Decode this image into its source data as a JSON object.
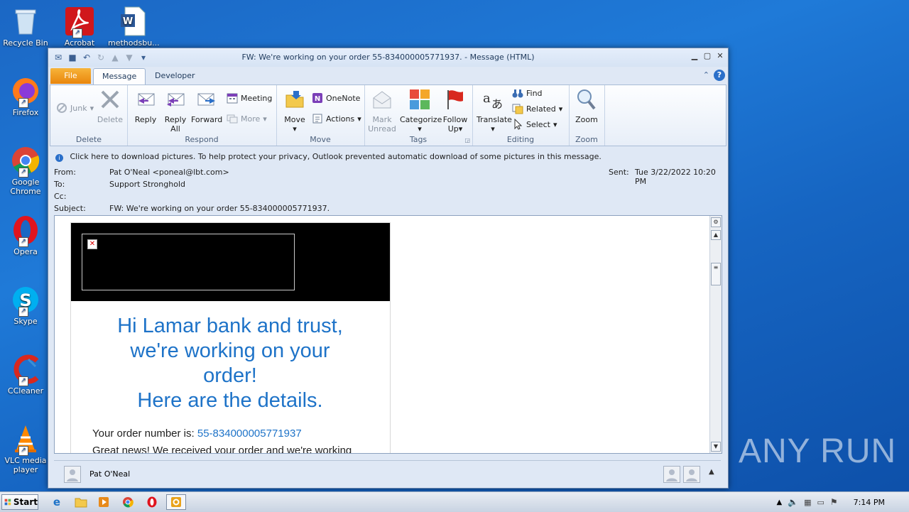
{
  "desktop": {
    "icons": [
      {
        "label": "Recycle Bin"
      },
      {
        "label": "Acrobat"
      },
      {
        "label": "methodsbu..."
      },
      {
        "label": "Firefox"
      },
      {
        "label": "Google Chrome"
      },
      {
        "label": "Opera"
      },
      {
        "label": "Skype"
      },
      {
        "label": "CCleaner"
      },
      {
        "label": "VLC media player"
      }
    ]
  },
  "window": {
    "title": "FW: We're working on your order 55-834000005771937. - Message (HTML)",
    "tabs": {
      "file": "File",
      "message": "Message",
      "developer": "Developer"
    }
  },
  "ribbon": {
    "groups": {
      "delete": "Delete",
      "respond": "Respond",
      "move": "Move",
      "tags": "Tags",
      "editing": "Editing",
      "zoom": "Zoom"
    },
    "buttons": {
      "junk": "Junk",
      "delete": "Delete",
      "reply": "Reply",
      "reply_all_1": "Reply",
      "reply_all_2": "All",
      "forward": "Forward",
      "meeting": "Meeting",
      "more": "More",
      "move": "Move",
      "onenote": "OneNote",
      "actions": "Actions",
      "mark_unread_1": "Mark",
      "mark_unread_2": "Unread",
      "categorize": "Categorize",
      "follow_up_1": "Follow",
      "follow_up_2": "Up",
      "translate": "Translate",
      "find": "Find",
      "related": "Related",
      "select": "Select",
      "zoom": "Zoom"
    }
  },
  "infobar": "Click here to download pictures. To help protect your privacy, Outlook prevented automatic download of some pictures in this message.",
  "header": {
    "from_label": "From:",
    "from_value": "Pat O'Neal <poneal@lbt.com>",
    "to_label": "To:",
    "to_value": "Support Stronghold",
    "cc_label": "Cc:",
    "subject_label": "Subject:",
    "subject_value": "FW: We're working on your order 55-834000005771937.",
    "sent_label": "Sent:",
    "sent_value": "Tue 3/22/2022 10:20 PM"
  },
  "email": {
    "heading_1": "Hi Lamar bank and trust,",
    "heading_2": "we're working on your",
    "heading_3": "order!",
    "heading_4": "Here are the details.",
    "order_label": "Your order number is: ",
    "order_number": "55-834000005771937",
    "great_news": "Great news! We received your order and we're working"
  },
  "people_pane": {
    "name": "Pat O'Neal"
  },
  "taskbar": {
    "start": "Start",
    "clock": "7:14 PM"
  },
  "watermark": "ANY RUN"
}
